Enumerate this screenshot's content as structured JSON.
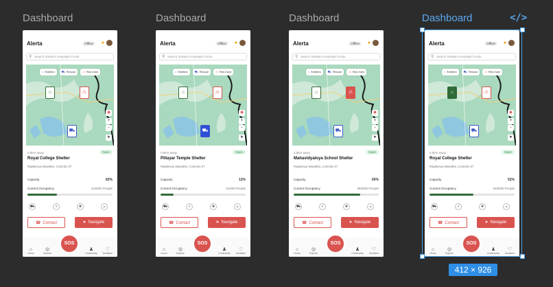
{
  "canvas": {
    "size_label": "412 × 926"
  },
  "app": {
    "title": "Alerta",
    "status": "Offline",
    "search_placeholder": "Search Shelters Hospitals Foods",
    "map_chips": [
      "Shelters",
      "Rescue",
      "Red Zone"
    ],
    "map_controls": [
      "+",
      "−"
    ],
    "labels": {
      "capacity": "Capacity",
      "occupancy": "Current Occupancy",
      "contact": "Contact",
      "navigate": "Navigate",
      "sos": "SOS"
    },
    "nav_items": [
      "Home",
      "Explore",
      "Community",
      "Donation"
    ]
  },
  "frames": [
    {
      "label": "Dashboard",
      "distance": "0.8km away",
      "status": "Open",
      "name": "Royal College Shelter",
      "address": "Rajakeeya Mawatha, Colombo 07",
      "capacity": "82%",
      "occupancy": "410/500 People",
      "occupancy_fraction": 0.35
    },
    {
      "label": "Dashboard",
      "distance": "0.8km away",
      "status": "Open",
      "name": "Pillayar Temple Shelter",
      "address": "Rajakeeya Mawatha, Colombo 07",
      "capacity": "12%",
      "occupancy": "11/500 People",
      "occupancy_fraction": 0.15
    },
    {
      "label": "Dashboard",
      "distance": "0.8km away",
      "status": "Open",
      "name": "Mahavidyaloya School Shelter",
      "address": "Rajakeeya Mawatha, Colombo 07",
      "capacity": "60%",
      "occupancy": "350/500 People",
      "occupancy_fraction": 0.78
    },
    {
      "label": "Dashboard",
      "distance": "0.8km away",
      "status": "Open",
      "name": "Royal College Shelter",
      "address": "Rajakeeya Mawatha, Colombo 07",
      "capacity": "52%",
      "occupancy": "540/500 People",
      "occupancy_fraction": 0.52
    }
  ],
  "colors": {
    "accent": "#d9534f",
    "selection": "#4aa3f0",
    "progress": "#2f6b35",
    "map": "#a9d9be"
  }
}
